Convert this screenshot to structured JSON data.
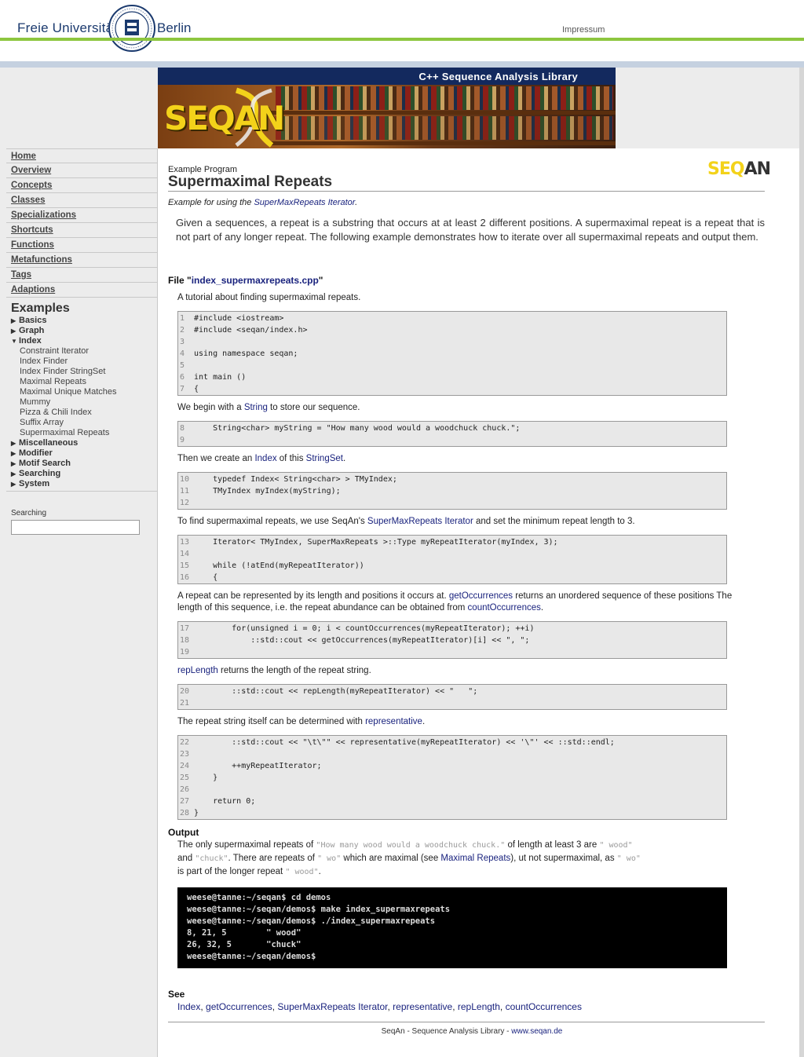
{
  "header": {
    "university_left": "Freie Universität",
    "university_right": "Berlin",
    "impressum": "Impressum"
  },
  "banner": {
    "title": "C++ Sequence Analysis Library",
    "logo": "SEQAN"
  },
  "sidebar": {
    "nav": [
      "Home",
      "Overview",
      "Concepts",
      "Classes",
      "Specializations",
      "Shortcuts",
      "Functions",
      "Metafunctions",
      "Tags",
      "Adaptions"
    ],
    "examples_heading": "Examples",
    "categories_before": [
      {
        "label": "Basics",
        "expanded": false
      },
      {
        "label": "Graph",
        "expanded": false
      },
      {
        "label": "Index",
        "expanded": true
      }
    ],
    "index_items": [
      "Constraint Iterator",
      "Index Finder",
      "Index Finder StringSet",
      "Maximal Repeats",
      "Maximal Unique Matches",
      "Mummy",
      "Pizza & Chili Index",
      "Suffix Array",
      "Supermaximal Repeats"
    ],
    "categories_after": [
      {
        "label": "Miscellaneous",
        "expanded": false
      },
      {
        "label": "Modifier",
        "expanded": false
      },
      {
        "label": "Motif Search",
        "expanded": false
      },
      {
        "label": "Searching",
        "expanded": false
      },
      {
        "label": "System",
        "expanded": false
      }
    ],
    "search_label": "Searching",
    "search_value": ""
  },
  "main": {
    "program_label": "Example Program",
    "title": "Supermaximal Repeats",
    "subtitle_prefix": "Example for using the ",
    "subtitle_link": "SuperMaxRepeats Iterator",
    "subtitle_suffix": ".",
    "intro": "Given a sequences, a repeat is a substring that occurs at at least 2 different positions. A supermaximal repeat is a repeat that is not part of any longer repeat. The following example demonstrates how to iterate over all supermaximal repeats and output them.",
    "file_prefix": "File \"",
    "file_name": "index_supermaxrepeats.cpp",
    "file_suffix": "\"",
    "p1": "A tutorial about finding supermaximal repeats.",
    "p2_a": "We begin with a ",
    "p2_link": "String",
    "p2_b": " to store our sequence.",
    "p3_a": "Then we create an ",
    "p3_link1": "Index",
    "p3_b": " of this ",
    "p3_link2": "StringSet",
    "p3_c": ".",
    "p4_a": "To find supermaximal repeats, we use SeqAn's ",
    "p4_link": "SuperMaxRepeats Iterator",
    "p4_b": " and set the minimum repeat length to 3.",
    "p5_a": "A repeat can be represented by its length and positions it occurs at. ",
    "p5_link1": "getOccurrences",
    "p5_b": " returns an unordered sequence of these positions The length of this sequence, i.e. the repeat abundance can be obtained from ",
    "p5_link2": "countOccurrences",
    "p5_c": ".",
    "p6_link": "repLength",
    "p6_b": " returns the length of the repeat string.",
    "p7_a": "The repeat string itself can be determined with ",
    "p7_link": "representative",
    "p7_b": ".",
    "code_blocks": [
      [
        [
          "1",
          "#include <iostream>"
        ],
        [
          "2",
          "#include <seqan/index.h>"
        ],
        [
          "3",
          ""
        ],
        [
          "4",
          "using namespace seqan;"
        ],
        [
          "5",
          ""
        ],
        [
          "6",
          "int main ()"
        ],
        [
          "7",
          "{"
        ]
      ],
      [
        [
          "8",
          "    String<char> myString = \"How many wood would a woodchuck chuck.\";"
        ],
        [
          "9",
          ""
        ]
      ],
      [
        [
          "10",
          "    typedef Index< String<char> > TMyIndex;"
        ],
        [
          "11",
          "    TMyIndex myIndex(myString);"
        ],
        [
          "12",
          ""
        ]
      ],
      [
        [
          "13",
          "    Iterator< TMyIndex, SuperMaxRepeats >::Type myRepeatIterator(myIndex, 3);"
        ],
        [
          "14",
          ""
        ],
        [
          "15",
          "    while (!atEnd(myRepeatIterator))"
        ],
        [
          "16",
          "    {"
        ]
      ],
      [
        [
          "17",
          "        for(unsigned i = 0; i < countOccurrences(myRepeatIterator); ++i)"
        ],
        [
          "18",
          "            ::std::cout << getOccurrences(myRepeatIterator)[i] << \", \";"
        ],
        [
          "19",
          ""
        ]
      ],
      [
        [
          "20",
          "        ::std::cout << repLength(myRepeatIterator) << \"   \";"
        ],
        [
          "21",
          ""
        ]
      ],
      [
        [
          "22",
          "        ::std::cout << \"\\t\\\"\" << representative(myRepeatIterator) << '\\\"' << ::std::endl;"
        ],
        [
          "23",
          ""
        ],
        [
          "24",
          "        ++myRepeatIterator;"
        ],
        [
          "25",
          "    }"
        ],
        [
          "26",
          ""
        ],
        [
          "27",
          "    return 0;"
        ],
        [
          "28",
          "}"
        ]
      ]
    ],
    "output_heading": "Output",
    "out_a": "The only supermaximal repeats of ",
    "out_q1": "\"How many wood would a woodchuck chuck.\"",
    "out_b": " of length at least 3 are ",
    "out_q2": "\" wood\"",
    "out_c": "and ",
    "out_q3": "\"chuck\"",
    "out_d": ". There are repeats of ",
    "out_q4": "\" wo\"",
    "out_e": " which are maximal (see ",
    "out_link": "Maximal Repeats",
    "out_f": "), ut not supermaximal, as ",
    "out_q5": "\" wo\"",
    "out_g": "is part of the longer repeat ",
    "out_q6": "\" wood\"",
    "out_h": ".",
    "terminal": [
      "weese@tanne:~/seqan$ cd demos",
      "weese@tanne:~/seqan/demos$ make index_supermaxrepeats",
      "weese@tanne:~/seqan/demos$ ./index_supermaxrepeats",
      "8, 21, 5        \" wood\"",
      "26, 32, 5       \"chuck\"",
      "weese@tanne:~/seqan/demos$"
    ],
    "see_heading": "See",
    "see_links": [
      "Index",
      "getOccurrences",
      "SuperMaxRepeats Iterator",
      "representative",
      "repLength",
      "countOccurrences"
    ],
    "footer_text": "SeqAn - Sequence Analysis Library - ",
    "footer_link": "www.seqan.de"
  },
  "colors": {
    "green_rule": "#8dc63f",
    "banner_blue": "#13295e",
    "link": "#1a237e",
    "logo_yellow": "#f3d21a"
  }
}
